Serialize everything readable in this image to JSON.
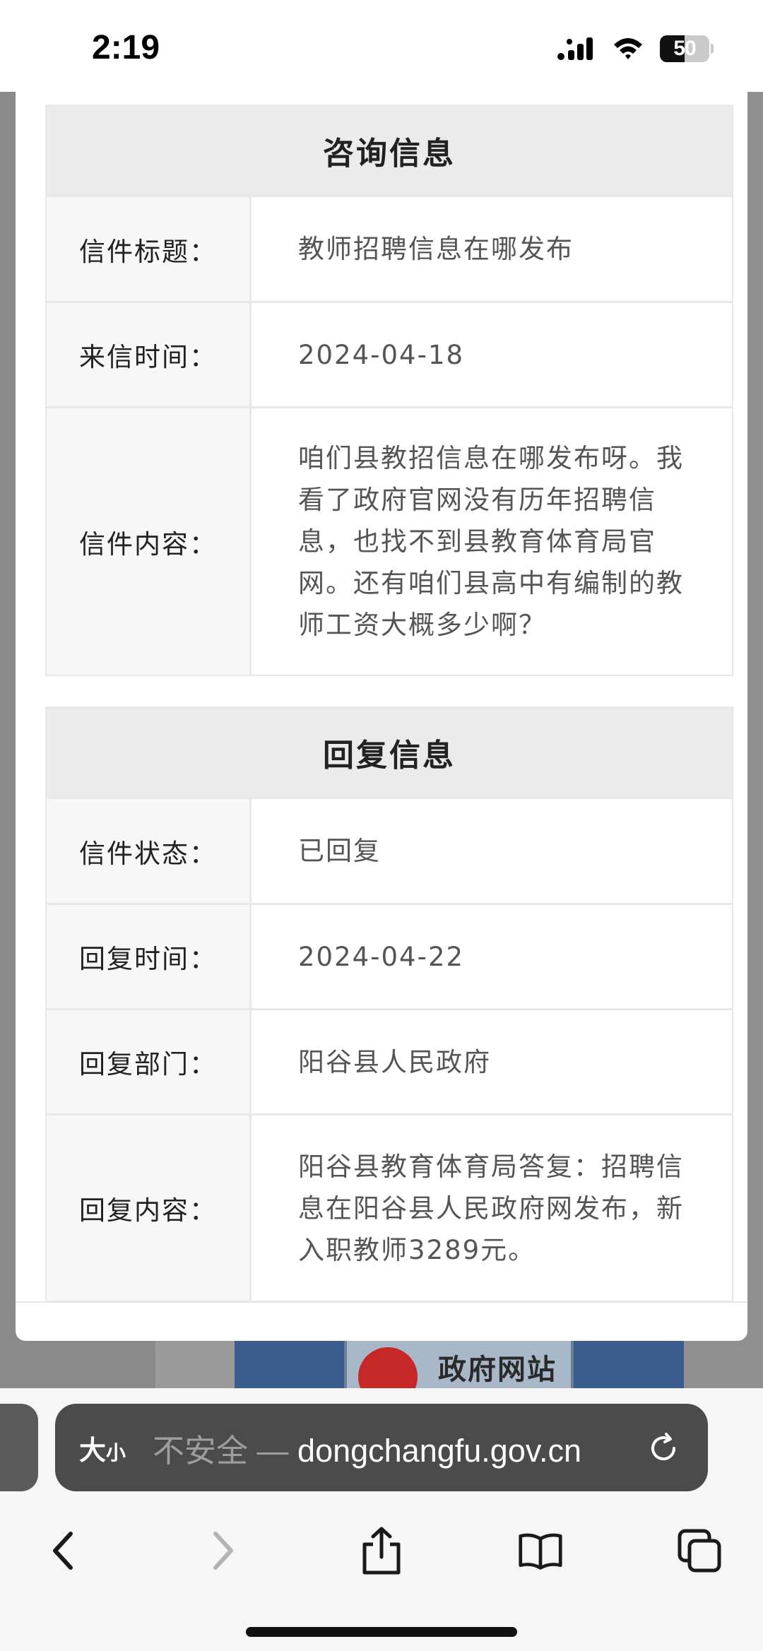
{
  "status_bar": {
    "time": "2:19",
    "battery": "50"
  },
  "inquiry": {
    "header": "咨询信息",
    "rows": [
      {
        "label": "信件标题：",
        "value": "教师招聘信息在哪发布"
      },
      {
        "label": "来信时间：",
        "value": "2024-04-18"
      },
      {
        "label": "信件内容：",
        "value": "咱们县教招信息在哪发布呀。我看了政府官网没有历年招聘信息，也找不到县教育体育局官网。还有咱们县高中有编制的教师工资大概多少啊？"
      }
    ]
  },
  "reply": {
    "header": "回复信息",
    "rows": [
      {
        "label": "信件状态：",
        "value": "已回复"
      },
      {
        "label": "回复时间：",
        "value": "2024-04-22"
      },
      {
        "label": "回复部门：",
        "value": "阳谷县人民政府"
      },
      {
        "label": "回复内容：",
        "value": "阳谷县教育体育局答复：招聘信息在阳谷县人民政府网发布，新入职教师3289元。"
      }
    ]
  },
  "background": {
    "banner_text": "政府网站"
  },
  "browser": {
    "reader_label": "大",
    "reader_label_small": "小",
    "url_prefix": "不安全 — ",
    "url_domain": "dongchangfu.gov.cn"
  },
  "icons": {
    "back": "chevron-left-icon",
    "forward": "chevron-right-icon",
    "share": "share-icon",
    "bookmarks": "book-icon",
    "tabs": "tabs-icon",
    "reload": "reload-icon"
  }
}
